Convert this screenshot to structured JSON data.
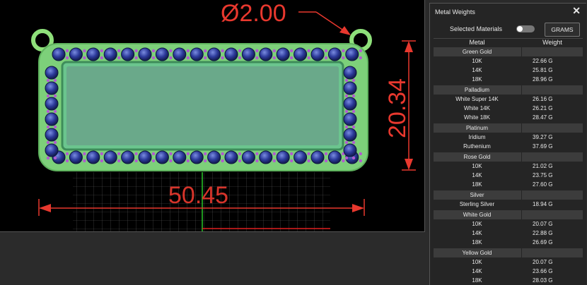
{
  "viewport": {
    "diameter_label": "Ø2.00",
    "height_label": "20.34",
    "width_label": "50.45",
    "accent_color": "#e8382e"
  },
  "panel": {
    "title": "Metal Weights",
    "close_icon": "close-icon",
    "selected_materials_label": "Selected Materials",
    "toggle_on": false,
    "unit_button": "GRAMS",
    "columns": {
      "metal": "Metal",
      "weight": "Weight"
    },
    "groups": [
      {
        "name": "Green Gold",
        "items": [
          {
            "metal": "10K",
            "weight": "22.66 G"
          },
          {
            "metal": "14K",
            "weight": "25.81 G"
          },
          {
            "metal": "18K",
            "weight": "28.96 G"
          }
        ]
      },
      {
        "name": "Palladium",
        "items": [
          {
            "metal": "White Super 14K",
            "weight": "26.16 G"
          },
          {
            "metal": "White 14K",
            "weight": "26.21 G"
          },
          {
            "metal": "White 18K",
            "weight": "28.47 G"
          }
        ]
      },
      {
        "name": "Platinum",
        "items": [
          {
            "metal": "Iridium",
            "weight": "39.27 G"
          },
          {
            "metal": "Ruthenium",
            "weight": "37.69 G"
          }
        ]
      },
      {
        "name": "Rose Gold",
        "items": [
          {
            "metal": "10K",
            "weight": "21.02 G"
          },
          {
            "metal": "14K",
            "weight": "23.75 G"
          },
          {
            "metal": "18K",
            "weight": "27.60 G"
          }
        ]
      },
      {
        "name": "Silver",
        "items": [
          {
            "metal": "Sterling Silver",
            "weight": "18.94 G"
          }
        ]
      },
      {
        "name": "White Gold",
        "items": [
          {
            "metal": "10K",
            "weight": "20.07 G"
          },
          {
            "metal": "14K",
            "weight": "22.88 G"
          },
          {
            "metal": "18K",
            "weight": "26.69 G"
          }
        ]
      },
      {
        "name": "Yellow Gold",
        "items": [
          {
            "metal": "10K",
            "weight": "20.07 G"
          },
          {
            "metal": "14K",
            "weight": "23.66 G"
          },
          {
            "metal": "18K",
            "weight": "28.03 G"
          }
        ]
      }
    ]
  }
}
